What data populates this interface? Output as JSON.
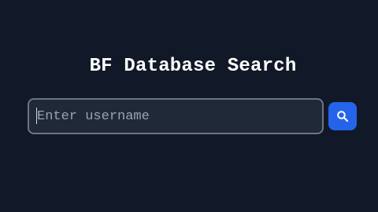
{
  "page": {
    "title": "BF Database Search"
  },
  "search": {
    "value": "",
    "placeholder": "Enter username",
    "button_icon": "search-icon"
  },
  "colors": {
    "background": "#111827",
    "input_background": "#1f2937",
    "input_border": "#6b7585",
    "accent": "#2563eb",
    "title_text": "#ffffff",
    "placeholder_text": "#9aa3b0"
  }
}
